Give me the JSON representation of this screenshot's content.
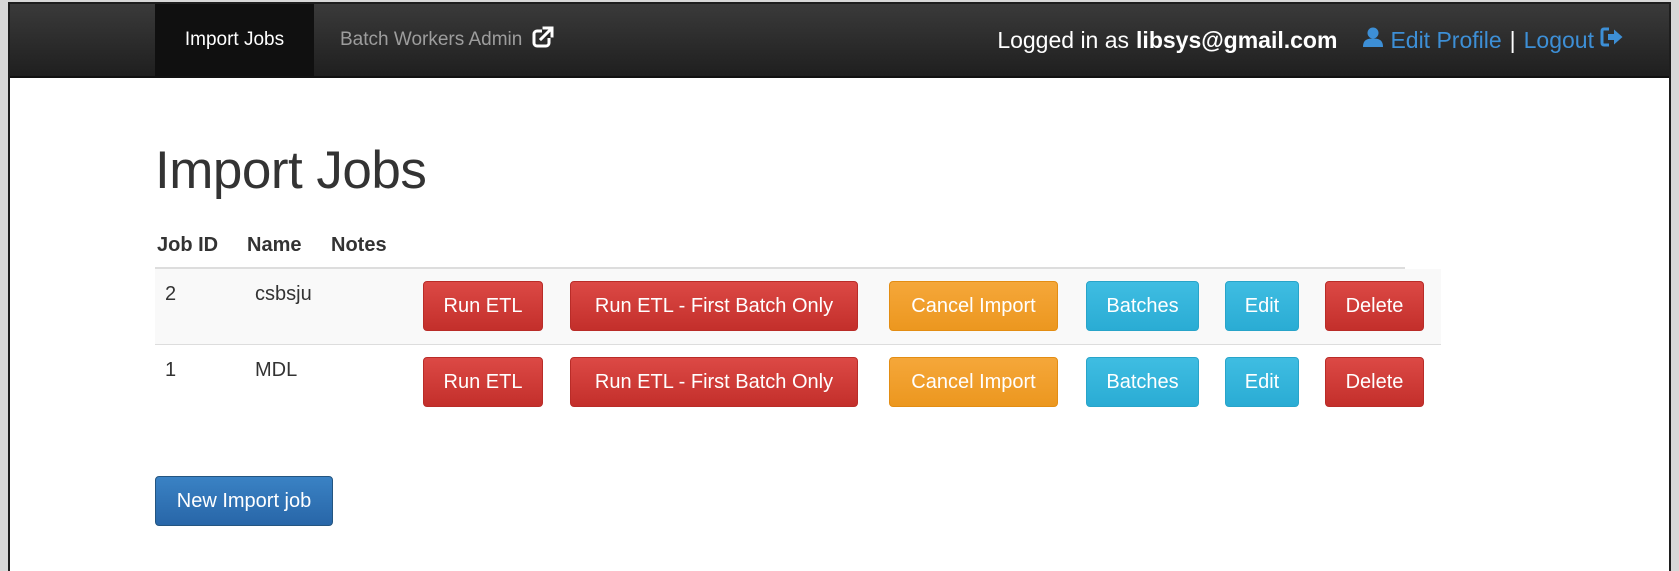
{
  "navbar": {
    "tabs": [
      {
        "label": "Import Jobs",
        "active": true
      },
      {
        "label": "Batch Workers Admin",
        "active": false,
        "icon": "external-link-icon"
      }
    ],
    "logged_in_prefix": "Logged in as",
    "user_email": "libsys@gmail.com",
    "edit_profile_label": "Edit Profile",
    "separator": "|",
    "logout_label": "Logout",
    "icons": {
      "user": "user-icon",
      "logout": "logout-icon"
    },
    "colors": {
      "background": "#222222",
      "link": "#3d8fd6"
    }
  },
  "page": {
    "title": "Import Jobs"
  },
  "table": {
    "columns": [
      "Job ID",
      "Name",
      "Notes"
    ],
    "rows": [
      {
        "job_id": "2",
        "name": "csbsju",
        "notes": ""
      },
      {
        "job_id": "1",
        "name": "MDL",
        "notes": ""
      }
    ],
    "actions": {
      "run_etl": "Run ETL",
      "run_first_batch": "Run ETL - First Batch Only",
      "cancel_import": "Cancel Import",
      "batches": "Batches",
      "edit": "Edit",
      "delete": "Delete"
    }
  },
  "new_job_button": "New Import job",
  "colors": {
    "danger": "#d9534f",
    "warning": "#f0ad4e",
    "info": "#5bc0de",
    "primary": "#337ab7"
  }
}
